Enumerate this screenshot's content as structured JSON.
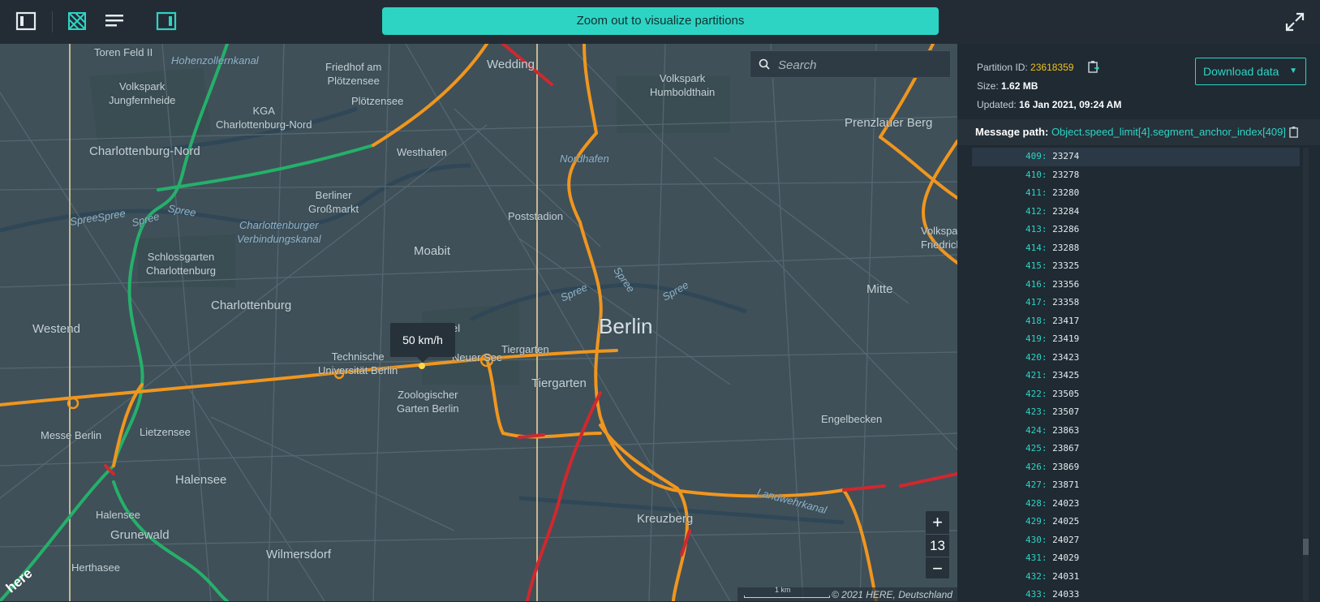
{
  "toolbar": {
    "icons": [
      "sidebar-left-icon",
      "partition-layer-icon",
      "list-icon",
      "sidebar-right-icon"
    ],
    "banner": "Zoom out to visualize partitions",
    "expand_icon": "fullscreen-icon"
  },
  "map": {
    "search_placeholder": "Search",
    "tooltip": "50 km/h",
    "zoom_level": "13",
    "zoom_in": "+",
    "zoom_out": "−",
    "scale_label": "1 km",
    "copyright": "© 2021 HERE, Deutschland",
    "logo": "here",
    "labels": {
      "toren_feld": "Toren Feld II",
      "hohenzollernkanal": "Hohenzollernkanal",
      "friedhof": "Friedhof am\nPlötzensee",
      "wedding": "Wedding",
      "volkspark_jungfernheide": "Volkspark\nJungfernheide",
      "kga": "KGA\nCharlottenburg-Nord",
      "ploetzensee": "Plötzensee",
      "volkspark_humboldthain": "Volkspark\nHumboldthain",
      "prenzlauer_berg": "Prenzlauer Berg",
      "charlottenburg_nord": "Charlottenburg-Nord",
      "westhafen": "Westhafen",
      "nordhafen": "Nordhafen",
      "spree1": "Spree",
      "spree2": "Spree",
      "spree3": "Spree",
      "spree4": "Spree",
      "spree5": "Spree",
      "spree6": "Spree",
      "spree7": "Spree",
      "berliner_grossmarkt": "Berliner\nGroßmarkt",
      "verbindungskanal": "Charlottenburger\nVerbindungskanal",
      "poststadion": "Poststadion",
      "volkspark_friedrichshain": "Volkspa\nFriedrichs",
      "schlossgarten": "Schlossgarten\nCharlottenburg",
      "moabit": "Moabit",
      "mitte": "Mitte",
      "charlottenburg": "Charlottenburg",
      "westend": "Westend",
      "berlin": "Berlin",
      "tu_berlin": "Technische\nUniversität Berlin",
      "neuer_see": "Neuer See",
      "tiergarten_park": "Tiergarten",
      "tiergarten": "Tiergarten",
      "zoo": "Zoologischer\nGarten Berlin",
      "engelbecken": "Engelbecken",
      "messe": "Messe Berlin",
      "lietzensee": "Lietzensee",
      "halensee": "Halensee",
      "halensee_lake": "Halensee",
      "kreuzberg": "Kreuzberg",
      "landwehrkanal": "Landwehrkanal",
      "grunewald": "Grunewald",
      "wilmersdorf": "Wilmersdorf",
      "herthasee": "Herthasee",
      "el": "el"
    }
  },
  "panel": {
    "partition_label": "Partition ID:",
    "partition_id": "23618359",
    "size_label": "Size:",
    "size": "1.62 MB",
    "updated_label": "Updated:",
    "updated": "16 Jan 2021, 09:24 AM",
    "download_label": "Download data",
    "message_path_label": "Message path:",
    "message_path": "Object.speed_limit[4].segment_anchor_index[409]",
    "rows": [
      {
        "k": "409",
        "v": "23274"
      },
      {
        "k": "410",
        "v": "23278"
      },
      {
        "k": "411",
        "v": "23280"
      },
      {
        "k": "412",
        "v": "23284"
      },
      {
        "k": "413",
        "v": "23286"
      },
      {
        "k": "414",
        "v": "23288"
      },
      {
        "k": "415",
        "v": "23325"
      },
      {
        "k": "416",
        "v": "23356"
      },
      {
        "k": "417",
        "v": "23358"
      },
      {
        "k": "418",
        "v": "23417"
      },
      {
        "k": "419",
        "v": "23419"
      },
      {
        "k": "420",
        "v": "23423"
      },
      {
        "k": "421",
        "v": "23425"
      },
      {
        "k": "422",
        "v": "23505"
      },
      {
        "k": "423",
        "v": "23507"
      },
      {
        "k": "424",
        "v": "23863"
      },
      {
        "k": "425",
        "v": "23867"
      },
      {
        "k": "426",
        "v": "23869"
      },
      {
        "k": "427",
        "v": "23871"
      },
      {
        "k": "428",
        "v": "24023"
      },
      {
        "k": "429",
        "v": "24025"
      },
      {
        "k": "430",
        "v": "24027"
      },
      {
        "k": "431",
        "v": "24029"
      },
      {
        "k": "432",
        "v": "24031"
      },
      {
        "k": "433",
        "v": "24033"
      }
    ]
  },
  "colors": {
    "accent": "#2dd4c4",
    "partition_id": "#f2c21a",
    "road_orange": "#f0961e",
    "road_green": "#25b06a",
    "road_red": "#d0282e",
    "map_bg": "#3f5059"
  }
}
